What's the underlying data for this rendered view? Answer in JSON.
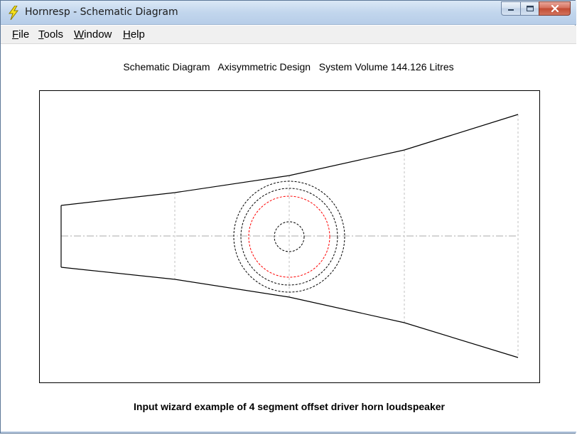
{
  "window": {
    "title": "Hornresp - Schematic Diagram",
    "app_icon": "lightning-bolt-icon",
    "buttons": [
      "minimize-icon",
      "maximize-icon",
      "close-icon"
    ]
  },
  "menu": {
    "items": [
      {
        "mnemonic": "F",
        "rest": "ile"
      },
      {
        "mnemonic": "T",
        "rest": "ools"
      },
      {
        "mnemonic": "W",
        "rest": "indow"
      },
      {
        "mnemonic": "H",
        "rest": "elp"
      }
    ]
  },
  "diagram": {
    "heading": "Schematic Diagram   Axisymmetric Design   System Volume 144.126 Litres",
    "caption": "Input wizard example of 4 segment offset driver horn loudspeaker",
    "colors": {
      "outline": "#000000",
      "guide": "#b0b0b0",
      "driver_outer": "#000000",
      "driver_cone": "#ff0000"
    }
  }
}
